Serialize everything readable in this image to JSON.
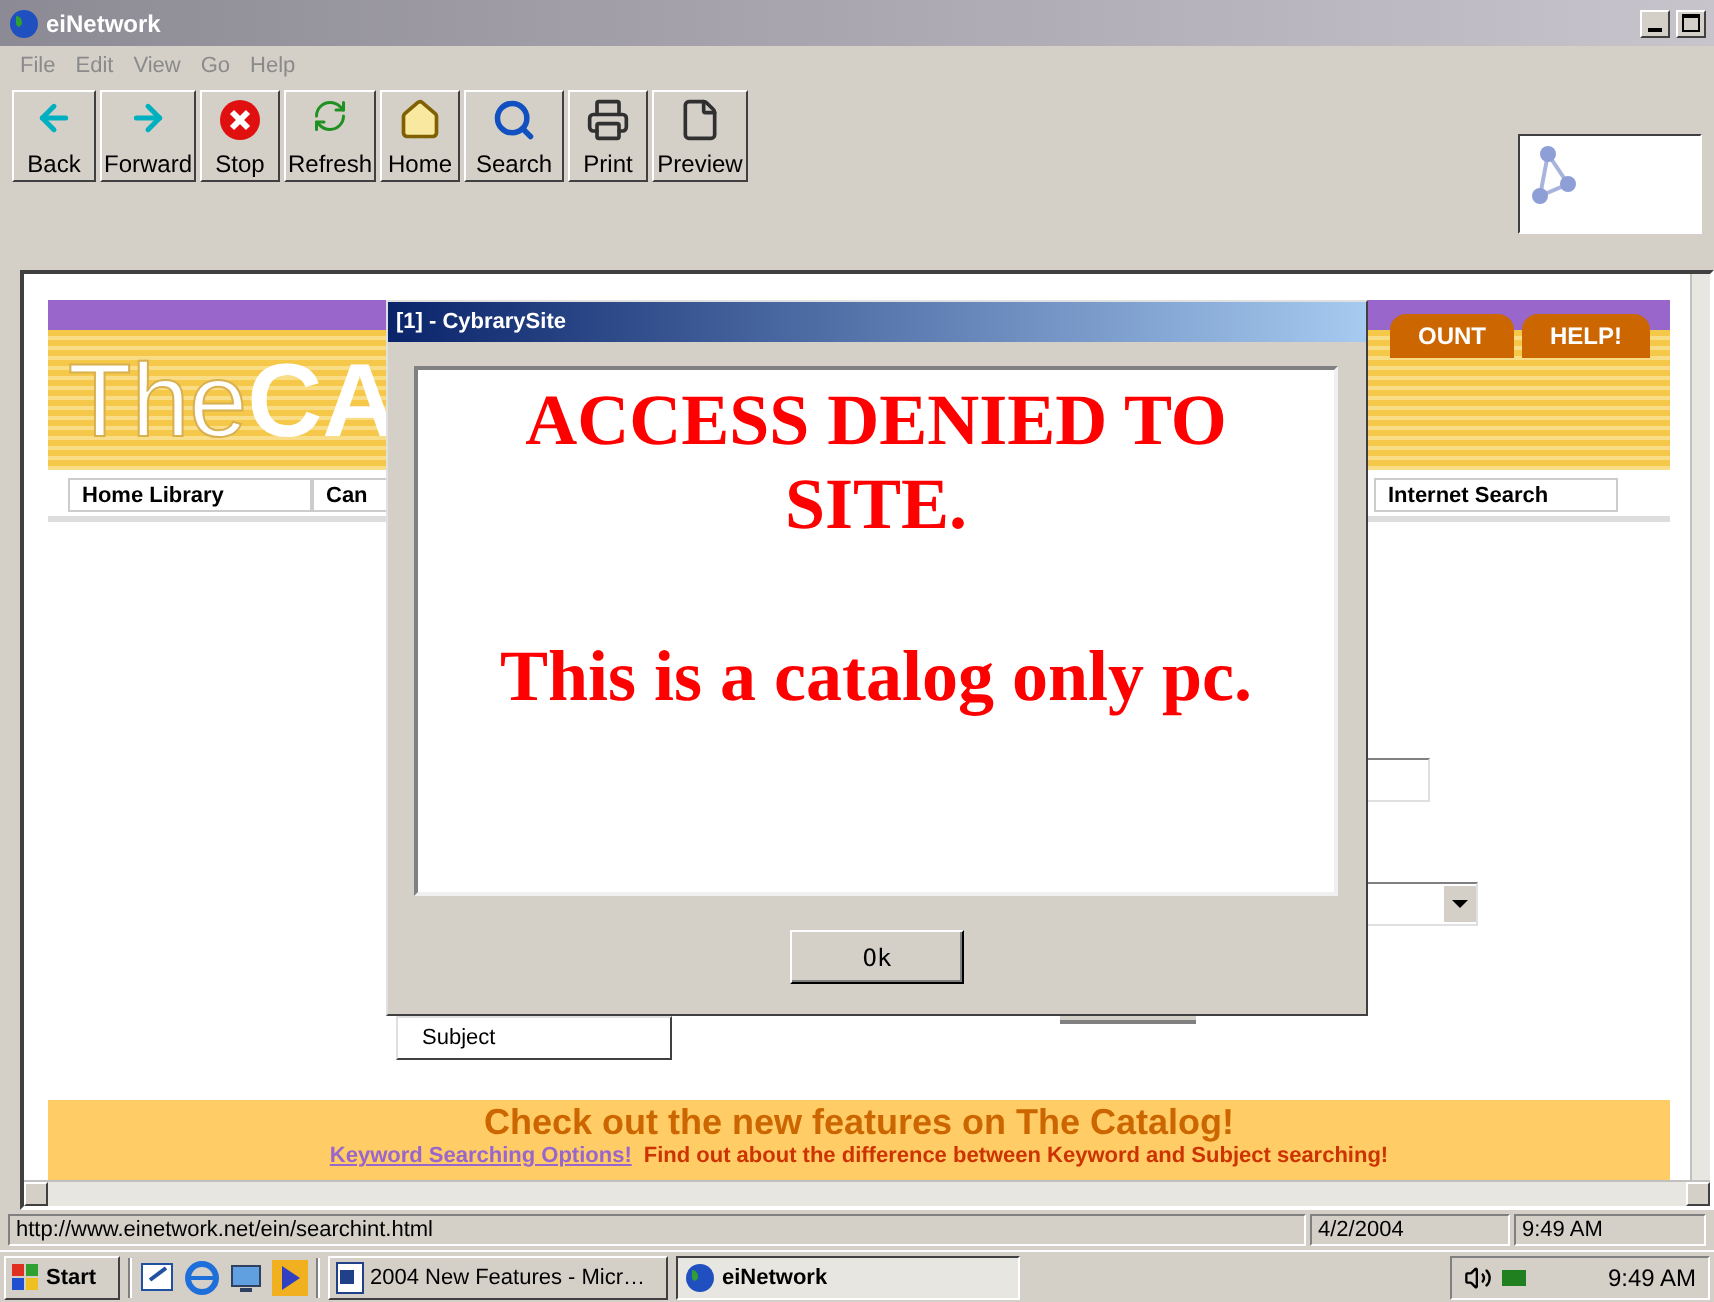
{
  "window": {
    "title": "eiNetwork"
  },
  "menu": [
    "File",
    "Edit",
    "View",
    "Go",
    "Help"
  ],
  "toolbar": [
    {
      "label": "Back",
      "kind": "back"
    },
    {
      "label": "Forward",
      "kind": "forward"
    },
    {
      "label": "Stop",
      "kind": "stop"
    },
    {
      "label": "Refresh",
      "kind": "refresh"
    },
    {
      "label": "Home",
      "kind": "home"
    },
    {
      "label": "Search",
      "kind": "search"
    },
    {
      "label": "Print",
      "kind": "print"
    },
    {
      "label": "Preview",
      "kind": "preview"
    }
  ],
  "page": {
    "banner": {
      "logo_light": "The",
      "logo_bold": "CA",
      "tabs": [
        "OUNT",
        "HELP!"
      ]
    },
    "nav": [
      "Home Library",
      "Can",
      "Internet Search"
    ],
    "subject_field": {
      "value": "Subject"
    },
    "promo": {
      "heading": "Check out the new features on The Catalog!",
      "link": "Keyword Searching Options!",
      "text": "Find out about the difference between Keyword and Subject searching!"
    }
  },
  "dialog": {
    "title": "[1] - CybrarySite",
    "message": [
      "ACCESS DENIED TO SITE.",
      "This is a catalog only pc."
    ],
    "button": "Ok"
  },
  "status_bar": {
    "url": "http://www.einetwork.net/ein/searchint.html",
    "date": "4/2/2004",
    "time": "9:49 AM"
  },
  "taskbar": {
    "start": "Start",
    "tasks": [
      {
        "label": "2004 New Features - Micr…",
        "selected": false,
        "kind": "word"
      },
      {
        "label": "eiNetwork",
        "selected": true,
        "kind": "globe"
      }
    ],
    "clock": "9:49 AM"
  }
}
